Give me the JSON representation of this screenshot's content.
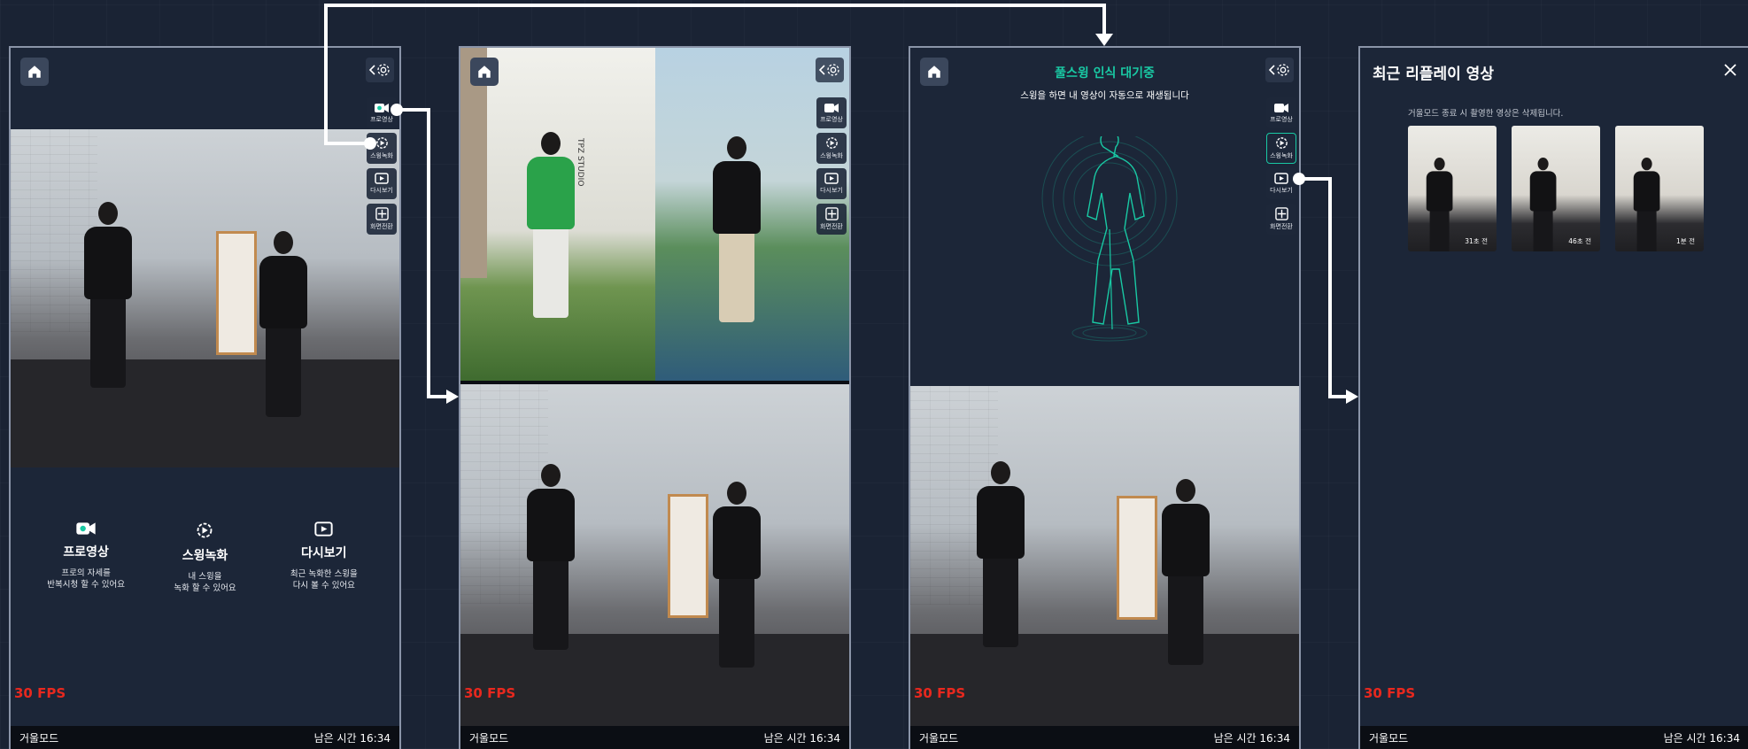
{
  "common": {
    "fps": "30 FPS",
    "mode": "거울모드",
    "remaining": "남은 시간 16:34"
  },
  "toolbar": {
    "pro_video": "프로영상",
    "swing_record": "스윙녹화",
    "replay": "다시보기",
    "switch_screen": "화면전환"
  },
  "panel1": {
    "features": [
      {
        "title": "프로영상",
        "desc": "프로의 자세를\n반복시청 할 수 있어요"
      },
      {
        "title": "스윙녹화",
        "desc": "내 스윙을\n녹화 할 수 있어요"
      },
      {
        "title": "다시보기",
        "desc": "최근 녹화한 스윙을\n다시 볼 수 있어요"
      }
    ]
  },
  "panel2": {
    "studio_sign": "TPZ STUDIO"
  },
  "panel3": {
    "title": "풀스윙 인식 대기중",
    "subtitle": "스윙을 하면 내 영상이 자동으로 재생됩니다"
  },
  "panel4": {
    "title": "최근 리플레이 영상",
    "note": "거울모드 종료 시 촬영한 영상은 삭제됩니다.",
    "thumbs": [
      {
        "time": "31초 전"
      },
      {
        "time": "46초 전"
      },
      {
        "time": "1분 전"
      }
    ]
  },
  "colors": {
    "accent": "#19c9a4",
    "fps": "#e8281e",
    "panel_bg": "#1c2638"
  }
}
